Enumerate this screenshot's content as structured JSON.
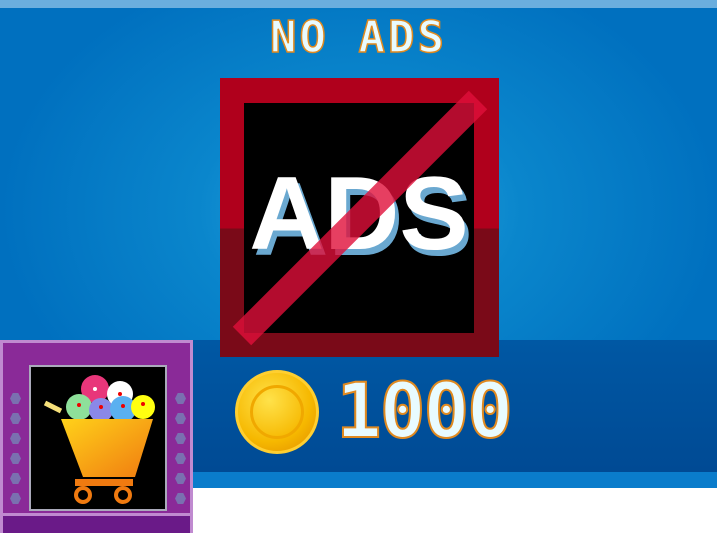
{
  "title": "NO ADS",
  "icon": {
    "label": "ADS",
    "name": "no-ads-icon"
  },
  "price": {
    "currency_icon": "coin-icon",
    "amount": "1000"
  },
  "shop_button": {
    "icon": "shopping-cart-icon"
  },
  "colors": {
    "bg": "#0070bf",
    "icon_red": "#b0001c",
    "shop_purple": "#8a2a98",
    "text": "#e8fbff",
    "outline": "#e08a20"
  }
}
